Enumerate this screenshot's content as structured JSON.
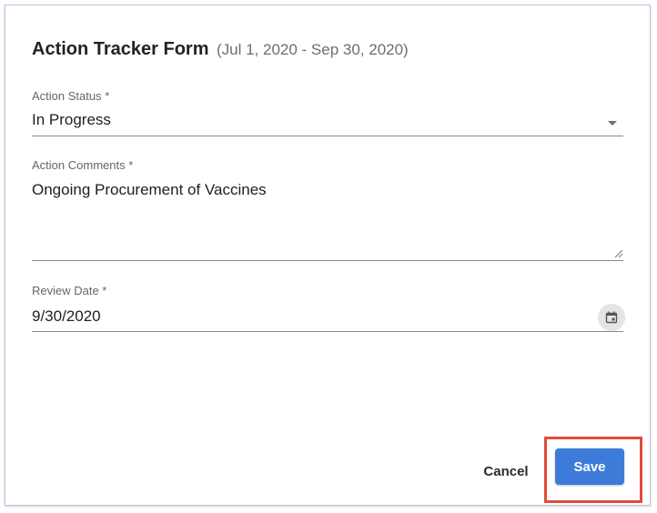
{
  "dialog": {
    "title": "Action Tracker Form",
    "period": "(Jul 1, 2020 - Sep 30, 2020)"
  },
  "fields": {
    "action_status": {
      "label": "Action Status *",
      "value": "In Progress"
    },
    "action_comments": {
      "label": "Action Comments *",
      "value": "Ongoing Procurement of Vaccines"
    },
    "review_date": {
      "label": "Review Date *",
      "value": "9/30/2020"
    }
  },
  "actions": {
    "cancel_label": "Cancel",
    "save_label": "Save"
  },
  "icons": {
    "dropdown": "chevron-down-icon",
    "calendar": "calendar-icon",
    "resize": "resize-handle-icon"
  },
  "colors": {
    "primary": "#3d7bd9",
    "highlight": "#e04c3a"
  }
}
